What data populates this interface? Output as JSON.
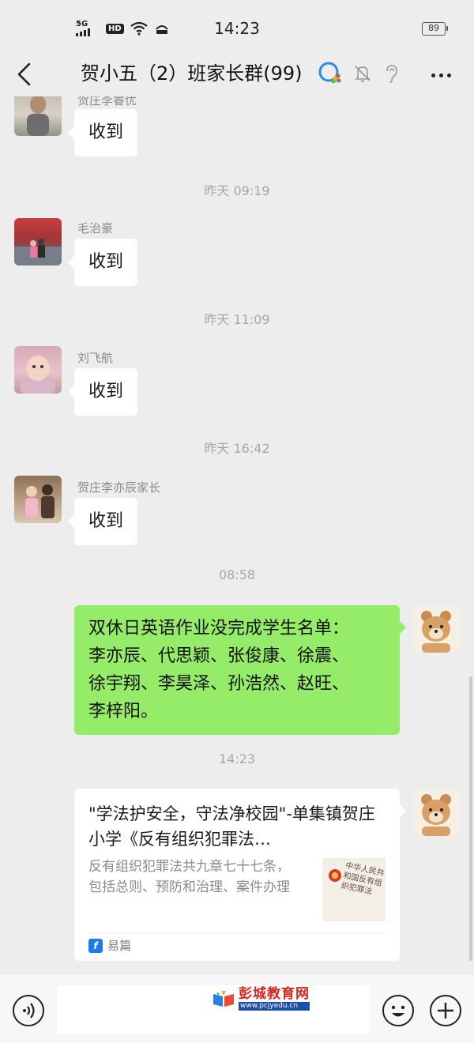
{
  "status_bar": {
    "network": "5G",
    "hd": "HD",
    "time": "14:23",
    "battery": "89"
  },
  "header": {
    "title": "贺小五（2）班家长群(99)"
  },
  "messages": [
    {
      "sender": "贺庄李睿优",
      "text": "收到"
    },
    {
      "timestamp": "昨天 09:19"
    },
    {
      "sender": "毛治豪",
      "text": "收到"
    },
    {
      "timestamp": "昨天 11:09"
    },
    {
      "sender": "刘飞航",
      "text": "收到"
    },
    {
      "timestamp": "昨天 16:42"
    },
    {
      "sender": "贺庄李亦辰家长",
      "text": "收到"
    },
    {
      "timestamp": "08:58"
    },
    {
      "text_lines": [
        "双休日英语作业没完成学生名单：",
        "李亦辰、代思颖、张俊康、徐震、",
        "徐宇翔、李昊泽、孙浩然、赵旺、",
        "李梓阳。"
      ]
    },
    {
      "timestamp": "14:23"
    }
  ],
  "card": {
    "title": "\"学法护安全，守法净校园\"-单集镇贺庄小学《反有组织犯罪法…",
    "description": "反有组织犯罪法共九章七十七条，包括总则、预防和治理、案件办理",
    "thumbnail_text": "中华人民共和国反有组织犯罪法",
    "source": "易篇",
    "source_icon": "yipian-logo-icon"
  },
  "input_bar": {
    "watermark_title": "彭城教育网",
    "watermark_url": "www.pcjyedu.cn"
  },
  "colors": {
    "background": "#ededed",
    "self_bubble": "#95ec69",
    "other_bubble": "#ffffff",
    "timestamp": "#a6a6a6"
  }
}
